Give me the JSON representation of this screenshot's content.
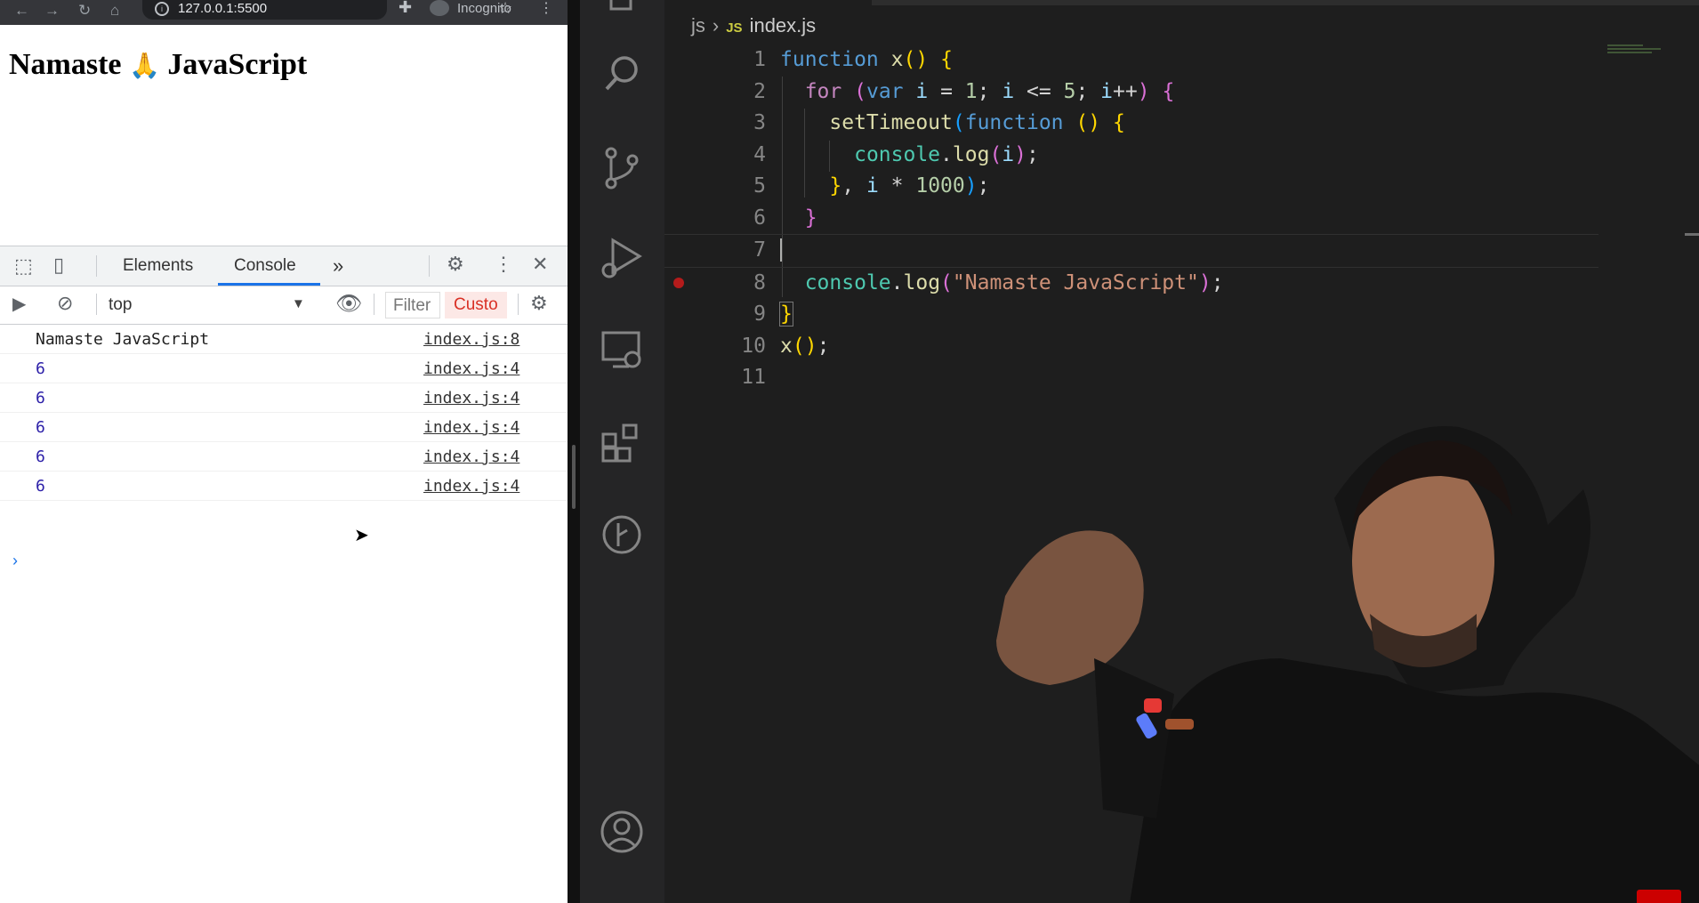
{
  "browser": {
    "url": "127.0.0.1:5500",
    "incognito_label": "Incognito",
    "page_heading": "Namaste 🙏 JavaScript",
    "heading_parts": {
      "before": "Namaste ",
      "emoji": "🙏",
      "after": " JavaScript"
    }
  },
  "devtools": {
    "tabs": [
      {
        "label": "Elements"
      },
      {
        "label": "Console"
      }
    ],
    "active_tab": "Console",
    "more_tabs": "»",
    "context": "top",
    "filter_placeholder": "Filter",
    "levels_label": "Custo",
    "console_rows": [
      {
        "message": "Namaste JavaScript",
        "source": "index.js:8",
        "type": "string"
      },
      {
        "message": "6",
        "source": "index.js:4",
        "type": "number"
      },
      {
        "message": "6",
        "source": "index.js:4",
        "type": "number"
      },
      {
        "message": "6",
        "source": "index.js:4",
        "type": "number"
      },
      {
        "message": "6",
        "source": "index.js:4",
        "type": "number"
      },
      {
        "message": "6",
        "source": "index.js:4",
        "type": "number"
      }
    ],
    "prompt": "›"
  },
  "editor": {
    "breadcrumb": {
      "folder": "js",
      "file": "index.js",
      "badge": "JS"
    },
    "line_numbers": [
      "1",
      "2",
      "3",
      "4",
      "5",
      "6",
      "7",
      "8",
      "9",
      "10",
      "11"
    ],
    "breakpoint_line": 8,
    "colors": {
      "background": "#1e1e1e",
      "keyword": "#569cd6",
      "control": "#c586c0",
      "function": "#dcdcaa",
      "variable": "#9cdcfe",
      "number": "#b5cea8",
      "string": "#ce9178",
      "bracket_1": "#ffd700",
      "bracket_2": "#da70d6",
      "bracket_3": "#179fff"
    }
  },
  "activity_bar": {
    "icons": [
      "files-icon",
      "search-icon",
      "source-control-icon",
      "run-debug-icon",
      "remote-explorer-icon",
      "extensions-icon",
      "git-graph-icon",
      "account-icon"
    ]
  }
}
